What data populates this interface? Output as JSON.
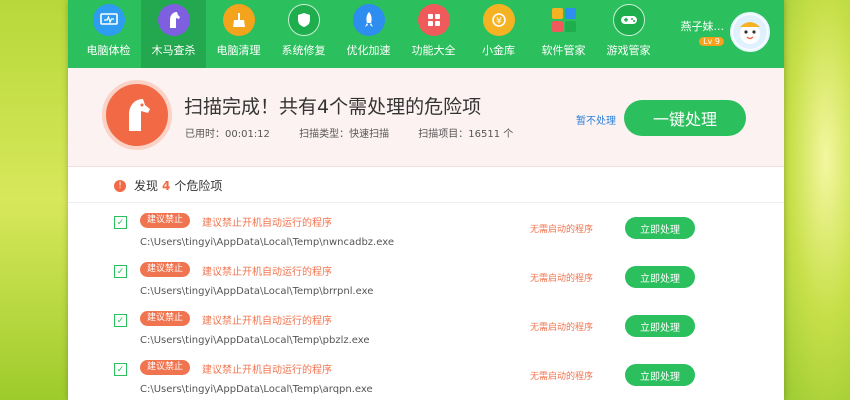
{
  "nav": {
    "items": [
      {
        "label": "电脑体检",
        "icon": "monitor-check-icon",
        "color": "#2e9cf0",
        "active": false
      },
      {
        "label": "木马查杀",
        "icon": "horse-icon",
        "color": "#7d5fe0",
        "active": true
      },
      {
        "label": "电脑清理",
        "icon": "broom-icon",
        "color": "#f3a31c",
        "active": false
      },
      {
        "label": "系统修复",
        "icon": "shield-icon",
        "color": "#1fae4e",
        "active": false
      },
      {
        "label": "优化加速",
        "icon": "rocket-icon",
        "color": "#2e8ef0",
        "active": false
      },
      {
        "label": "功能大全",
        "icon": "grid-icon",
        "color": "#f05a5a",
        "active": false
      },
      {
        "label": "小金库",
        "icon": "coin-icon",
        "color": "#f5b324",
        "active": false
      },
      {
        "label": "软件管家",
        "icon": "apps-icon",
        "color": "#ffffff",
        "active": false
      },
      {
        "label": "游戏管家",
        "icon": "gamepad-icon",
        "color": "#1fae4e",
        "active": false
      }
    ]
  },
  "user": {
    "name": "燕子妹...",
    "level": "Lv 9"
  },
  "summary": {
    "title": "扫描完成！共有4个需处理的危险项",
    "elapsed": "已用时：00:01:12",
    "scan_type": "扫描类型：快速扫描",
    "scan_items": "扫描项目：16511 个",
    "pause_label": "暂不处理",
    "action_label": "一键处理"
  },
  "found": {
    "prefix": "发现",
    "count": "4",
    "suffix": "个危险项"
  },
  "rows": [
    {
      "tag": "建议禁止",
      "title": "建议禁止开机自动运行的程序",
      "path": "C:\\Users\\tingyi\\AppData\\Local\\Temp\\nwncadbz.exe",
      "reason": "无需启动的程序",
      "button": "立即处理"
    },
    {
      "tag": "建议禁止",
      "title": "建议禁止开机自动运行的程序",
      "path": "C:\\Users\\tingyi\\AppData\\Local\\Temp\\brrpnl.exe",
      "reason": "无需启动的程序",
      "button": "立即处理"
    },
    {
      "tag": "建议禁止",
      "title": "建议禁止开机自动运行的程序",
      "path": "C:\\Users\\tingyi\\AppData\\Local\\Temp\\pbzlz.exe",
      "reason": "无需启动的程序",
      "button": "立即处理"
    },
    {
      "tag": "建议禁止",
      "title": "建议禁止开机自动运行的程序",
      "path": "C:\\Users\\tingyi\\AppData\\Local\\Temp\\arqpn.exe",
      "reason": "无需启动的程序",
      "button": "立即处理"
    }
  ],
  "colors": {
    "brand_green": "#2bbf5d",
    "danger_orange": "#f0744f",
    "link_blue": "#2b7fd8"
  }
}
